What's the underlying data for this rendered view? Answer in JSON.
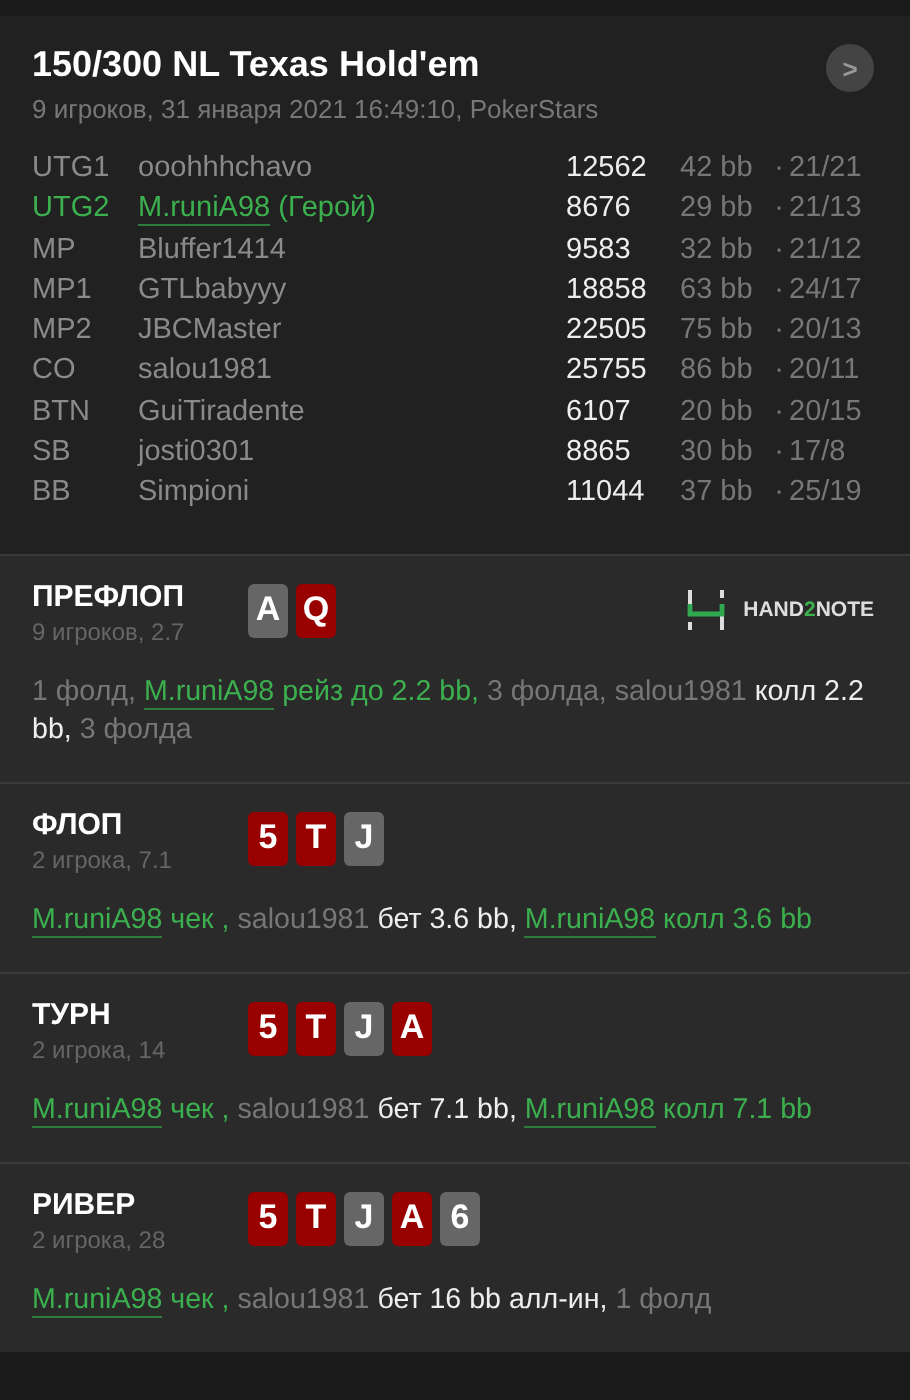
{
  "header": {
    "title": "150/300 NL Texas Hold'em",
    "subtitle": "9 игроков, 31 января 2021 16:49:10, PokerStars",
    "next_icon": ">"
  },
  "players": [
    {
      "position": "UTG1",
      "name": "ooohhhchavo",
      "hero": false,
      "stack": "12562",
      "bb": "42 bb",
      "sep": "·",
      "stats": "21/21"
    },
    {
      "position": "UTG2",
      "name": "M.runiA98",
      "tag": "(Герой)",
      "hero": true,
      "stack": "8676",
      "bb": "29 bb",
      "sep": "·",
      "stats": "21/13"
    },
    {
      "position": "MP",
      "name": "Bluffer1414",
      "hero": false,
      "stack": "9583",
      "bb": "32 bb",
      "sep": "·",
      "stats": "21/12"
    },
    {
      "position": "MP1",
      "name": "GTLbabyyy",
      "hero": false,
      "stack": "18858",
      "bb": "63 bb",
      "sep": "·",
      "stats": "24/17"
    },
    {
      "position": "MP2",
      "name": "JBCMaster",
      "hero": false,
      "stack": "22505",
      "bb": "75 bb",
      "sep": "·",
      "stats": "20/13"
    },
    {
      "position": "CO",
      "name": "salou1981",
      "hero": false,
      "stack": "25755",
      "bb": "86 bb",
      "sep": "·",
      "stats": "20/11"
    },
    {
      "position": "BTN",
      "name": "GuiTiradente",
      "hero": false,
      "stack": "6107",
      "bb": "20 bb",
      "sep": "·",
      "stats": "20/15"
    },
    {
      "position": "SB",
      "name": "josti0301",
      "hero": false,
      "stack": "8865",
      "bb": "30 bb",
      "sep": "·",
      "stats": "17/8"
    },
    {
      "position": "BB",
      "name": "Simpioni",
      "hero": false,
      "stack": "11044",
      "bb": "37 bb",
      "sep": "·",
      "stats": "25/19"
    }
  ],
  "streets": [
    {
      "title": "ПРЕФЛОП",
      "subtitle": "9 игроков, 2.7",
      "logo": [
        {
          "text": "HAND",
          "accent": false
        },
        {
          "text": "2",
          "accent": true
        },
        {
          "text": "NOTE",
          "accent": false
        }
      ],
      "cards": [
        {
          "rank": "A",
          "color": "#666666"
        },
        {
          "rank": "Q",
          "color": "#990000"
        }
      ],
      "actions": [
        {
          "kind": "muted",
          "text": "1 фолд, "
        },
        {
          "kind": "hero-name",
          "text": "M.runiA98"
        },
        {
          "kind": "hero",
          "text": " рейз до 2.2 bb,"
        },
        {
          "kind": "muted",
          "text": " 3 фолда, salou1981 "
        },
        {
          "kind": "bright",
          "text": "колл 2.2 bb,"
        },
        {
          "kind": "muted",
          "text": " 3 фолда"
        }
      ]
    },
    {
      "title": "ФЛОП",
      "subtitle": "2 игрока, 7.1",
      "cards": [
        {
          "rank": "5",
          "color": "#990000"
        },
        {
          "rank": "T",
          "color": "#990000"
        },
        {
          "rank": "J",
          "color": "#666666"
        }
      ],
      "actions": [
        {
          "kind": "hero-name",
          "text": "M.runiA98"
        },
        {
          "kind": "hero",
          "text": " чек ,"
        },
        {
          "kind": "muted",
          "text": " salou1981 "
        },
        {
          "kind": "bright",
          "text": "бет 3.6 bb, "
        },
        {
          "kind": "hero-name",
          "text": "M.runiA98"
        },
        {
          "kind": "hero",
          "text": " колл 3.6 bb"
        }
      ]
    },
    {
      "title": "ТУРН",
      "subtitle": "2 игрока, 14",
      "cards": [
        {
          "rank": "5",
          "color": "#990000"
        },
        {
          "rank": "T",
          "color": "#990000"
        },
        {
          "rank": "J",
          "color": "#666666"
        },
        {
          "rank": "A",
          "color": "#990000"
        }
      ],
      "actions": [
        {
          "kind": "hero-name",
          "text": "M.runiA98"
        },
        {
          "kind": "hero",
          "text": " чек ,"
        },
        {
          "kind": "muted",
          "text": " salou1981 "
        },
        {
          "kind": "bright",
          "text": "бет 7.1 bb, "
        },
        {
          "kind": "hero-name",
          "text": "M.runiA98"
        },
        {
          "kind": "hero",
          "text": " колл 7.1 bb"
        }
      ]
    },
    {
      "title": "РИВЕР",
      "subtitle": "2 игрока, 28",
      "cards": [
        {
          "rank": "5",
          "color": "#990000"
        },
        {
          "rank": "T",
          "color": "#990000"
        },
        {
          "rank": "J",
          "color": "#666666"
        },
        {
          "rank": "A",
          "color": "#990000"
        },
        {
          "rank": "6",
          "color": "#666666"
        }
      ],
      "actions": [
        {
          "kind": "hero-name",
          "text": "M.runiA98"
        },
        {
          "kind": "hero",
          "text": " чек ,"
        },
        {
          "kind": "muted",
          "text": " salou1981 "
        },
        {
          "kind": "bright",
          "text": "бет 16 bb алл-ин,"
        },
        {
          "kind": "muted",
          "text": " 1 фолд"
        }
      ]
    }
  ]
}
